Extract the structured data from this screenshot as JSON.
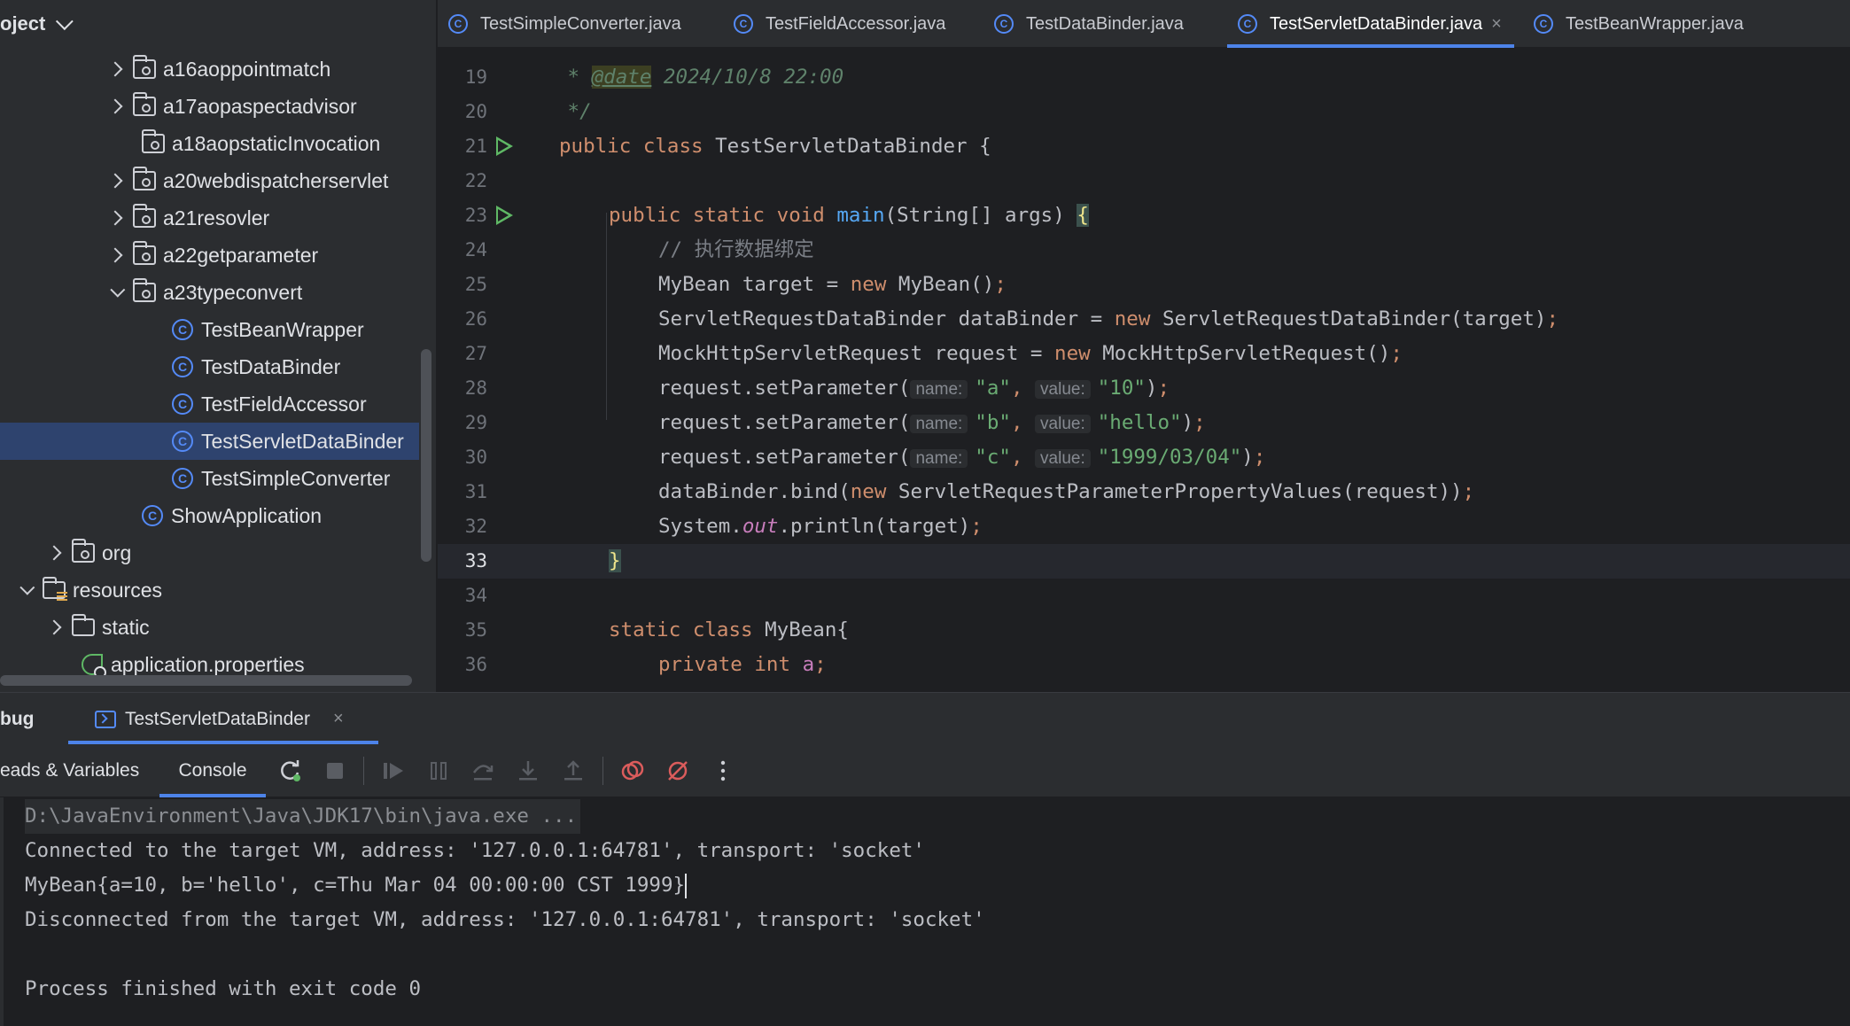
{
  "project_panel": {
    "title": "oject",
    "items": [
      {
        "label": "a16aoppointmatch",
        "icon": "package-icon",
        "expand": "collapsed"
      },
      {
        "label": "a17aopaspectadvisor",
        "icon": "package-icon",
        "expand": "collapsed"
      },
      {
        "label": "a18aopstaticInvocation",
        "icon": "package-icon",
        "expand": "none"
      },
      {
        "label": "a20webdispatcherservlet",
        "icon": "package-icon",
        "expand": "collapsed"
      },
      {
        "label": "a21resovler",
        "icon": "package-icon",
        "expand": "collapsed"
      },
      {
        "label": "a22getparameter",
        "icon": "package-icon",
        "expand": "collapsed"
      },
      {
        "label": "a23typeconvert",
        "icon": "package-icon",
        "expand": "expanded"
      },
      {
        "label": "TestBeanWrapper",
        "icon": "class-icon",
        "expand": "none"
      },
      {
        "label": "TestDataBinder",
        "icon": "class-icon",
        "expand": "none"
      },
      {
        "label": "TestFieldAccessor",
        "icon": "class-icon",
        "expand": "none"
      },
      {
        "label": "TestServletDataBinder",
        "icon": "class-icon",
        "expand": "none",
        "selected": true
      },
      {
        "label": "TestSimpleConverter",
        "icon": "class-icon",
        "expand": "none"
      },
      {
        "label": "ShowApplication",
        "icon": "spring-boot-class-icon",
        "expand": "none"
      },
      {
        "label": "org",
        "icon": "package-icon",
        "expand": "collapsed"
      },
      {
        "label": "resources",
        "icon": "resources-folder-icon",
        "expand": "expanded"
      },
      {
        "label": "static",
        "icon": "folder-icon",
        "expand": "collapsed"
      },
      {
        "label": "application.properties",
        "icon": "spring-properties-icon",
        "expand": "none"
      }
    ]
  },
  "editor_tabs": [
    {
      "label": "TestSimpleConverter.java",
      "active": false
    },
    {
      "label": "TestFieldAccessor.java",
      "active": false
    },
    {
      "label": "TestDataBinder.java",
      "active": false
    },
    {
      "label": "TestServletDataBinder.java",
      "active": true,
      "close": "×"
    },
    {
      "label": "TestBeanWrapper.java",
      "active": false
    }
  ],
  "editor": {
    "line_numbers": [
      "19",
      "20",
      "21",
      "22",
      "23",
      "24",
      "25",
      "26",
      "27",
      "28",
      "29",
      "30",
      "31",
      "32",
      "33",
      "34",
      "35",
      "36"
    ],
    "current_line": "33",
    "code": {
      "l19_star": " * ",
      "l19_tag": "@date",
      "l19_text": " 2024/10/8 22:00",
      "l20": " */",
      "l21_kw": "public class ",
      "l21_name": "TestServletDataBinder {",
      "l23_kw": "public static void ",
      "l23_fn": "main",
      "l23_rest": "(String[] args) ",
      "l23_brace": "{",
      "l24": "// 执行数据绑定",
      "l25_a": "MyBean target = ",
      "l25_kw": "new",
      "l25_b": " MyBean()",
      "l26_a": "ServletRequestDataBinder dataBinder = ",
      "l26_kw": "new",
      "l26_b": " ServletRequestDataBinder(target)",
      "l27_a": "MockHttpServletRequest request = ",
      "l27_kw": "new",
      "l27_b": " MockHttpServletRequest()",
      "l28_a": "request.setParameter(",
      "l28_h1": "name:",
      "l28_s1": "\"a\"",
      "l28_h2": "value:",
      "l28_s2": "\"10\"",
      "l29_a": "request.setParameter(",
      "l29_h1": "name:",
      "l29_s1": "\"b\"",
      "l29_h2": "value:",
      "l29_s2": "\"hello\"",
      "l30_a": "request.setParameter(",
      "l30_h1": "name:",
      "l30_s1": "\"c\"",
      "l30_h2": "value:",
      "l30_s2": "\"1999/03/04\"",
      "l31_a": "dataBinder.bind(",
      "l31_kw": "new",
      "l31_b": " ServletRequestParameterPropertyValues(request))",
      "l32_a": "System.",
      "l32_out": "out",
      "l32_b": ".println(target)",
      "semi": ";",
      "comma": ", ",
      "close_paren": ")",
      "l33": "}",
      "l35_kw": "static class ",
      "l35_name": "MyBean{",
      "l36_kw": "private int ",
      "l36_field": "a"
    }
  },
  "debug_panel": {
    "title": "bug",
    "session_tab": "TestServletDataBinder",
    "close": "×",
    "threads_tab": "eads & Variables",
    "console_tab": "Console",
    "toolbar_icons": [
      "rerun-icon",
      "stop-icon",
      "resume-icon",
      "pause-icon",
      "step-over-icon",
      "step-into-icon",
      "step-out-icon",
      "view-breakpoints-icon",
      "mute-breakpoints-icon",
      "more-icon"
    ]
  },
  "console": {
    "lines": [
      "D:\\JavaEnvironment\\Java\\JDK17\\bin\\java.exe ...",
      "Connected to the target VM, address: '127.0.0.1:64781', transport: 'socket'",
      "MyBean{a=10, b='hello', c=Thu Mar 04 00:00:00 CST 1999}",
      "Disconnected from the target VM, address: '127.0.0.1:64781', transport: 'socket'",
      "",
      "Process finished with exit code 0"
    ]
  },
  "colors": {
    "accent": "#4d83e9",
    "selection": "#2e436e",
    "keyword": "#cf8e6d",
    "string": "#6aab73",
    "function": "#56a8f5"
  }
}
